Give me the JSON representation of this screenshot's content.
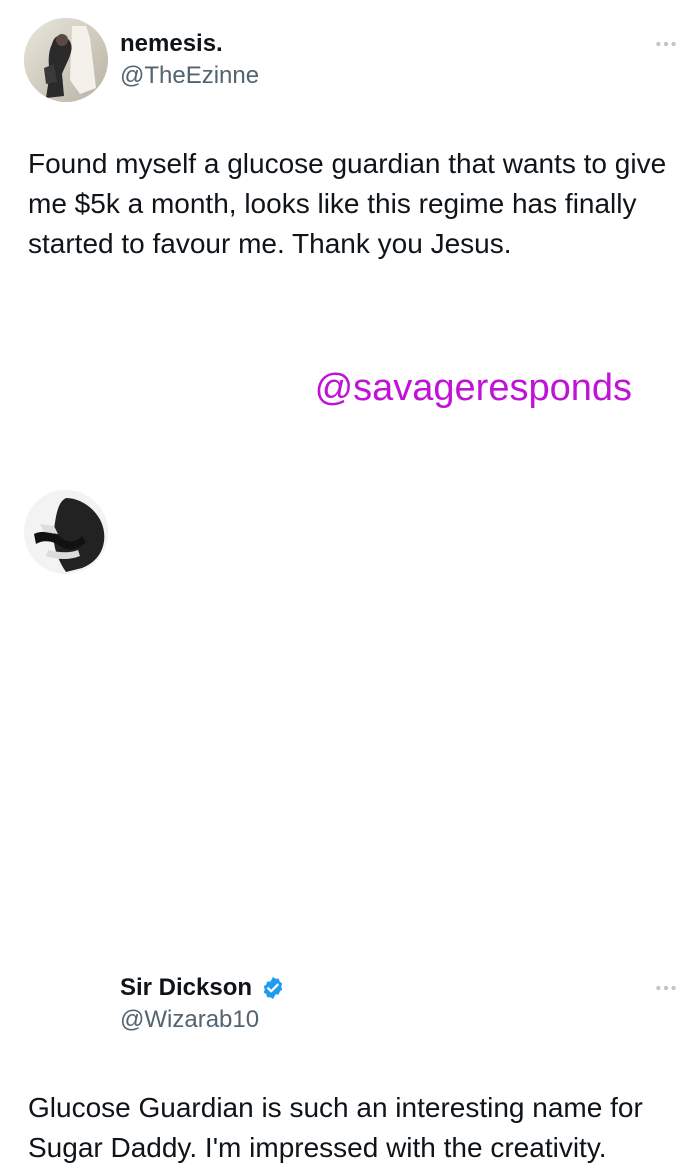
{
  "tweets": [
    {
      "display_name": "nemesis.",
      "handle": "@TheEzinne",
      "verified": false,
      "more_icon": "more-icon",
      "text": "Found myself a glucose guardian that wants to give me $5k a month, looks like this regime has finally started to favour me. Thank you Jesus."
    },
    {
      "display_name": "Sir Dickson",
      "handle": "@Wizarab10",
      "verified": true,
      "verified_icon": "verified-badge-icon",
      "more_icon": "more-icon",
      "text": "Glucose Guardian is such an interesting name for Sugar Daddy. I'm impressed with the creativity."
    }
  ],
  "watermark": {
    "text": "@savageresponds",
    "color": "#c112d8"
  },
  "colors": {
    "text": "#0f1419",
    "secondary_text": "#536471",
    "verified_badge": "#1d9bf0",
    "more_icon": "#c4c4c4"
  }
}
